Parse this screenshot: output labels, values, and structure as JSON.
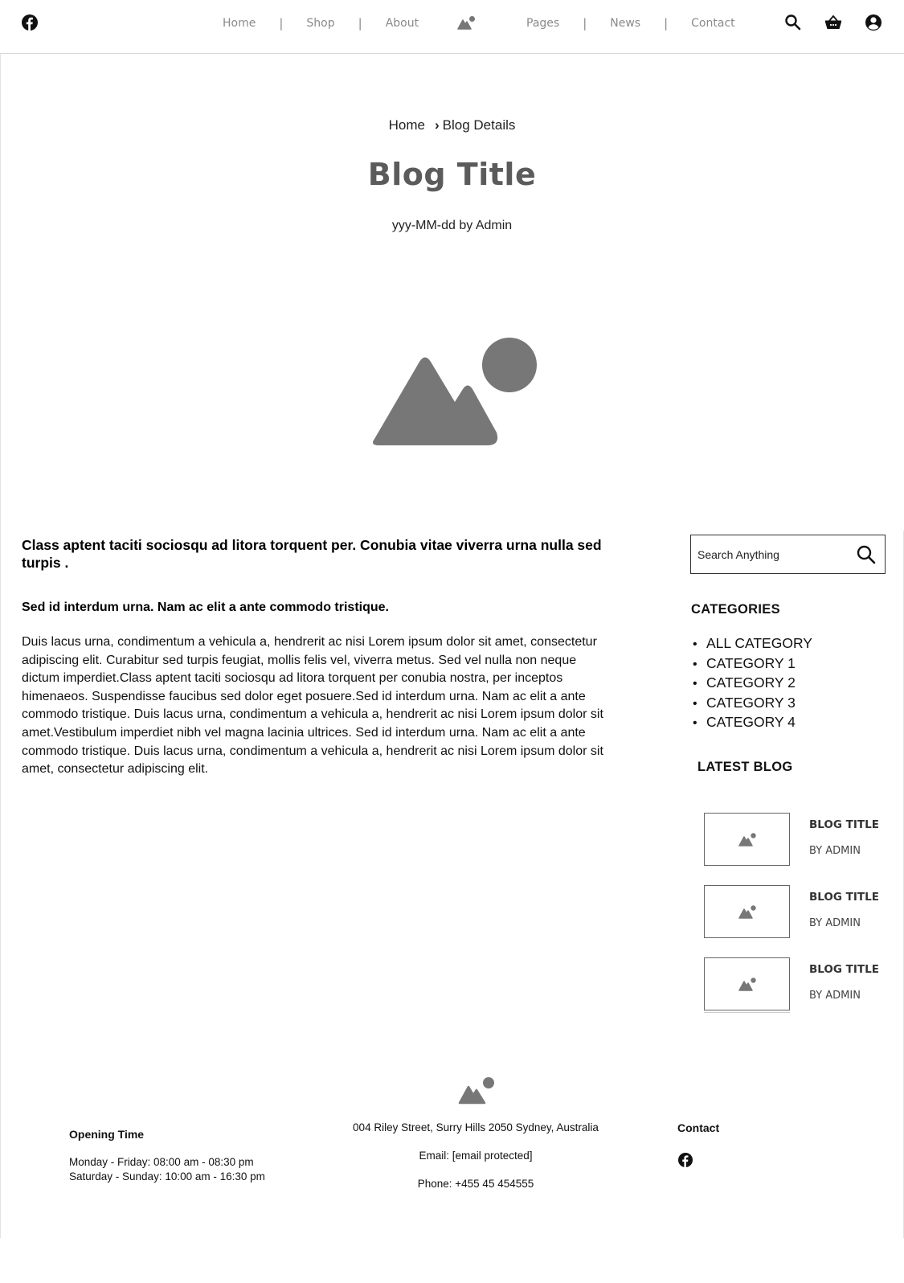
{
  "header": {
    "nav_left": [
      "Home",
      "Shop",
      "About"
    ],
    "nav_right": [
      "Pages",
      "News",
      "Contact"
    ],
    "separator": "|",
    "icons": [
      "facebook-icon",
      "logo-mountain-icon",
      "search-icon",
      "basket-icon",
      "user-icon"
    ]
  },
  "hero": {
    "breadcrumb_home": "Home",
    "breadcrumb_chevron": "›",
    "breadcrumb_current": "Blog Details",
    "title": "Blog Title",
    "meta": "yyy-MM-dd by Admin"
  },
  "article": {
    "lead": "Class aptent taciti sociosqu ad litora torquent per. Conubia vitae viverra urna nulla sed turpis .",
    "subheading": "Sed id interdum urna. Nam ac elit a ante commodo tristique.",
    "body": "Duis lacus urna, condimentum a vehicula a, hendrerit ac nisi Lorem ipsum dolor sit amet, consectetur adipiscing elit. Curabitur sed turpis feugiat, mollis felis vel, viverra metus. Sed vel nulla non neque dictum imperdiet.Class aptent taciti sociosqu ad litora torquent per conubia nostra, per inceptos himenaeos. Suspendisse faucibus sed dolor eget posuere.Sed id interdum urna. Nam ac elit a ante commodo tristique. Duis lacus urna, condimentum a vehicula a, hendrerit ac nisi Lorem ipsum dolor sit amet.Vestibulum imperdiet nibh vel magna lacinia ultrices. Sed id interdum urna. Nam ac elit a ante commodo tristique. Duis lacus urna, condimentum a vehicula a, hendrerit ac nisi Lorem ipsum dolor sit amet, consectetur adipiscing elit."
  },
  "sidebar": {
    "search_placeholder": "Search Anything",
    "categories_heading": "CATEGORIES",
    "categories": [
      "ALL  CATEGORY",
      "CATEGORY 1",
      "CATEGORY 2",
      "CATEGORY 3",
      "CATEGORY 4"
    ],
    "latest_heading": "LATEST BLOG",
    "latest": [
      {
        "title": "BLOG TITLE",
        "by": "BY ADMIN"
      },
      {
        "title": "BLOG TITLE",
        "by": "BY ADMIN"
      },
      {
        "title": "BLOG TITLE",
        "by": "BY ADMIN"
      }
    ]
  },
  "footer": {
    "opening_heading": "Opening Time",
    "opening_weekday": "Monday - Friday: 08:00 am - 08:30 pm",
    "opening_weekend": "Saturday - Sunday: 10:00 am - 16:30 pm",
    "address": "004 Riley Street, Surry Hills 2050 Sydney, Australia",
    "email": "Email: [email protected]",
    "phone": "Phone: +455 45 454555",
    "contact_heading": "Contact"
  },
  "colors": {
    "placeholder_gray": "#777777",
    "nav_text": "#8a8a8a",
    "title_gray": "#5b5b5b"
  }
}
